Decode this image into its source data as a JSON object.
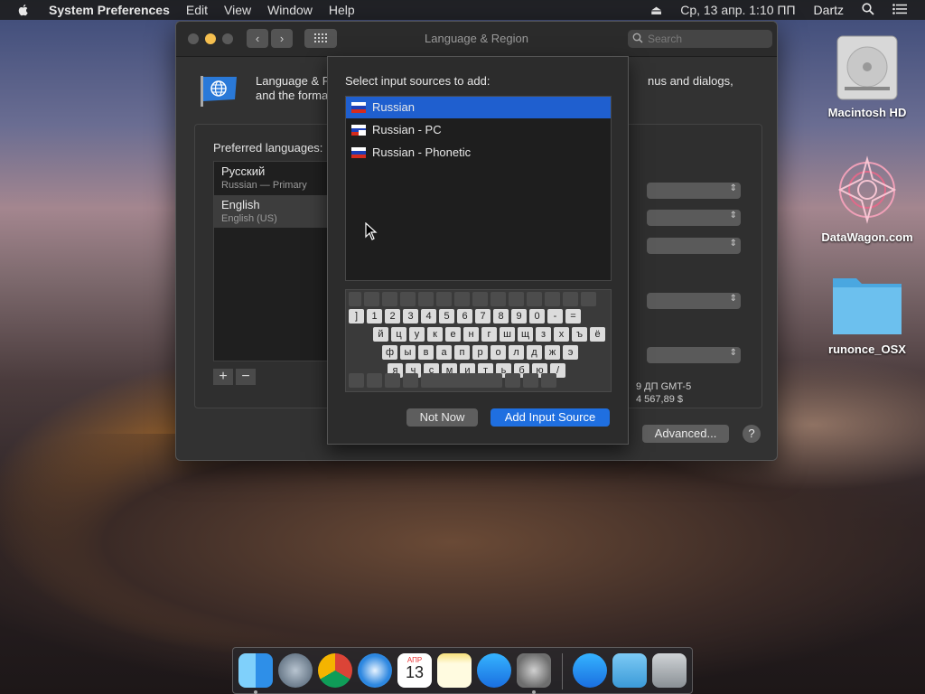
{
  "menubar": {
    "app_name": "System Preferences",
    "menus": [
      "Edit",
      "View",
      "Window",
      "Help"
    ],
    "datetime": "Ср, 13 апр.  1:10 ПП",
    "user": "Dartz"
  },
  "window": {
    "title": "Language & Region",
    "search_placeholder": "Search",
    "description_line1_left": "Language & R",
    "description_line1_right": "nus and dialogs,",
    "description_line2_left": "and the forma",
    "preferred_label": "Preferred languages:",
    "languages": [
      {
        "name": "Русский",
        "sub": "Russian — Primary"
      },
      {
        "name": "English",
        "sub": "English (US)"
      }
    ],
    "add_label": "+",
    "remove_label": "−",
    "format_line1": "9 ДП GMT-5",
    "format_line2": "4 567,89 $",
    "advanced_label": "Advanced...",
    "help_label": "?"
  },
  "sheet": {
    "title": "Select input sources to add:",
    "sources": [
      {
        "label": "Russian",
        "selected": true
      },
      {
        "label": "Russian - PC",
        "selected": false
      },
      {
        "label": "Russian - Phonetic",
        "selected": false
      }
    ],
    "keyboard_rows": [
      [
        "]",
        "1",
        "2",
        "3",
        "4",
        "5",
        "6",
        "7",
        "8",
        "9",
        "0",
        "-",
        "="
      ],
      [
        "й",
        "ц",
        "у",
        "к",
        "е",
        "н",
        "г",
        "ш",
        "щ",
        "з",
        "х",
        "ъ",
        "ё"
      ],
      [
        "ф",
        "ы",
        "в",
        "а",
        "п",
        "р",
        "о",
        "л",
        "д",
        "ж",
        "э"
      ],
      [
        "я",
        "ч",
        "с",
        "м",
        "и",
        "т",
        "ь",
        "б",
        "ю",
        "/"
      ]
    ],
    "not_now_label": "Not Now",
    "add_label": "Add Input Source",
    "accent_color": "#1f6fe0"
  },
  "desktop": {
    "icons": [
      {
        "label": "Macintosh HD",
        "icon": "hard-drive-icon"
      },
      {
        "label": "DataWagon.com",
        "icon": "mandala-icon"
      },
      {
        "label": "runonce_OSX",
        "icon": "folder-icon"
      }
    ]
  },
  "dock": {
    "apps": [
      "finder-icon",
      "launchpad-icon",
      "chrome-icon",
      "safari-icon",
      "calendar-icon",
      "notes-icon",
      "app-store-icon",
      "system-preferences-icon",
      "app-store-icon",
      "folder-icon",
      "trash-icon"
    ],
    "calendar_month": "АПР",
    "calendar_day": "13"
  }
}
